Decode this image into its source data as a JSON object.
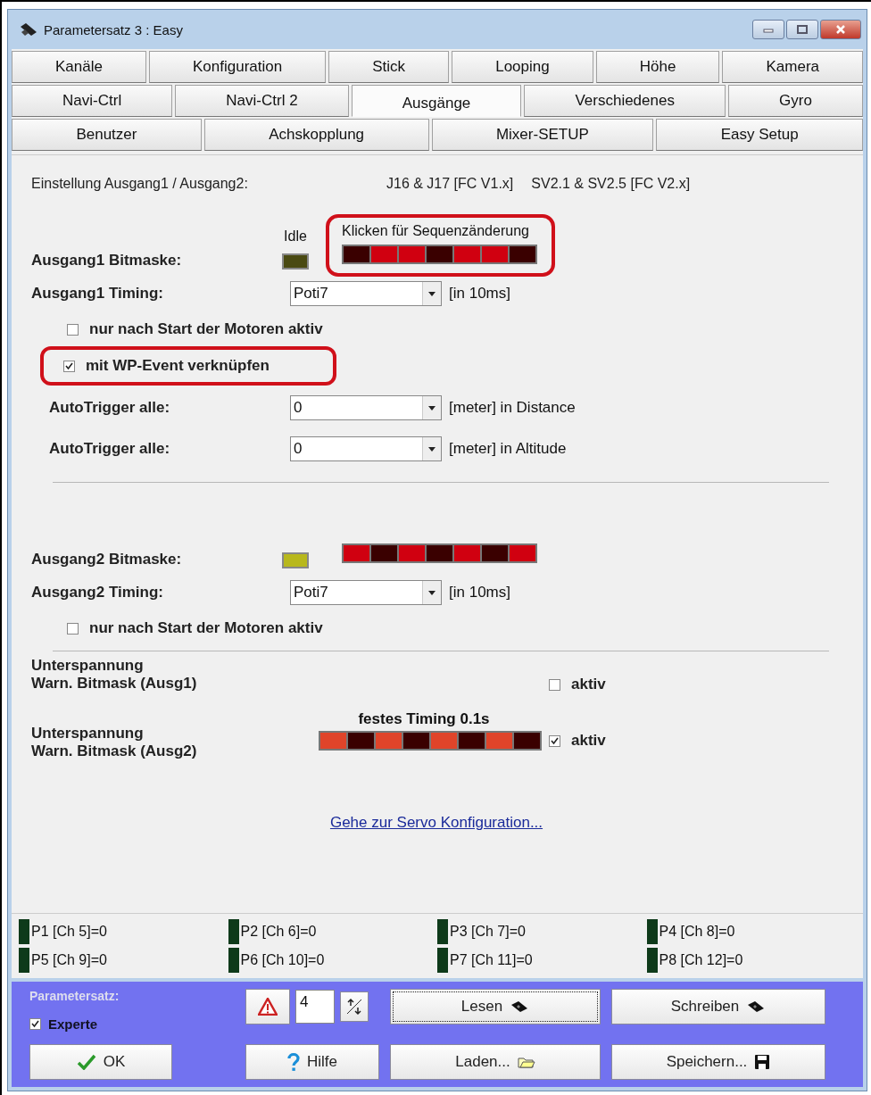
{
  "window": {
    "title": "Parametersatz 3 : Easy"
  },
  "tab_rows": [
    [
      {
        "label": "Kanäle",
        "selected": false
      },
      {
        "label": "Konfiguration",
        "selected": false
      },
      {
        "label": "Stick",
        "selected": false
      },
      {
        "label": "Looping",
        "selected": false
      },
      {
        "label": "Höhe",
        "selected": false
      },
      {
        "label": "Kamera",
        "selected": false
      }
    ],
    [
      {
        "label": "Navi-Ctrl",
        "selected": false
      },
      {
        "label": "Navi-Ctrl 2",
        "selected": false
      },
      {
        "label": "Ausgänge",
        "selected": true
      },
      {
        "label": "Verschiedenes",
        "selected": false
      },
      {
        "label": "Gyro",
        "selected": false
      }
    ],
    [
      {
        "label": "Benutzer",
        "selected": false
      },
      {
        "label": "Achskopplung",
        "selected": false
      },
      {
        "label": "Mixer-SETUP",
        "selected": false
      },
      {
        "label": "Easy Setup",
        "selected": false
      }
    ]
  ],
  "header": {
    "label": "Einstellung Ausgang1 / Ausgang2:",
    "value_1": "J16 & J17 [FC V1.x]",
    "value_2": "SV2.1 & SV2.5 [FC V2.x]"
  },
  "output_1": {
    "bitmask_label": "Ausgang1 Bitmaske:",
    "idle_label": "Idle",
    "idle": {
      "color": "#4a4a12"
    },
    "sequence_label": "Klicken für Sequenzänderung",
    "highlighted": true,
    "bits": [
      false,
      true,
      true,
      false,
      true,
      true,
      false
    ],
    "timing_label": "Ausgang1 Timing:",
    "timing_value": "Poti7",
    "timing_unit": "[in 10ms]",
    "motor_check": {
      "label": "nur nach Start der Motoren aktiv",
      "checked": false
    },
    "wp_check": {
      "label": "mit WP-Event verknüpfen",
      "checked": true,
      "highlighted": true
    },
    "triggers": [
      {
        "label": "AutoTrigger alle:",
        "value": "0",
        "unit": "[meter] in Distance"
      },
      {
        "label": "AutoTrigger alle:",
        "value": "0",
        "unit": "[meter] in Altitude"
      }
    ]
  },
  "output_2": {
    "bitmask_label": "Ausgang2 Bitmaske:",
    "idle": {
      "color": "#b8b81c"
    },
    "bits": [
      true,
      false,
      true,
      false,
      true,
      false,
      true
    ],
    "timing_label": "Ausgang2 Timing:",
    "timing_value": "Poti7",
    "timing_unit": "[in 10ms]",
    "motor_check": {
      "label": "nur nach Start der Motoren aktiv",
      "checked": false
    }
  },
  "undervoltage": {
    "label_1": "Unterspannung\nWarn. Bitmask (Ausg1)",
    "check_1": {
      "label": "aktiv",
      "checked": false
    },
    "timing_note": "festes Timing 0.1s",
    "label_2": "Unterspannung\nWarn. Bitmask (Ausg2)",
    "bits": [
      true,
      false,
      true,
      false,
      true,
      false,
      true,
      false
    ],
    "check_2": {
      "label": "aktiv",
      "checked": true
    }
  },
  "servo_link": "Gehe zur Servo Konfiguration...",
  "pots": [
    {
      "label": "P1 [Ch 5]=0",
      "on": false
    },
    {
      "label": "P2 [Ch 6]=0",
      "on": false
    },
    {
      "label": "P3 [Ch 7]=0",
      "on": false
    },
    {
      "label": "P4 [Ch 8]=0",
      "on": false
    },
    {
      "label": "P5 [Ch 9]=0",
      "on": false
    },
    {
      "label": "P6 [Ch 10]=0",
      "on": false
    },
    {
      "label": "P7 [Ch 11]=0",
      "on": false
    },
    {
      "label": "P8 [Ch 12]=0",
      "on": false
    }
  ],
  "footer": {
    "set_label": "Parametersatz:",
    "expert": {
      "label": "Experte",
      "checked": true
    },
    "set_number": "4",
    "read": {
      "label": "Lesen",
      "focused": true
    },
    "write": "Schreiben",
    "ok": "OK",
    "help": "Hilfe",
    "load": "Laden...",
    "save": "Speichern..."
  }
}
